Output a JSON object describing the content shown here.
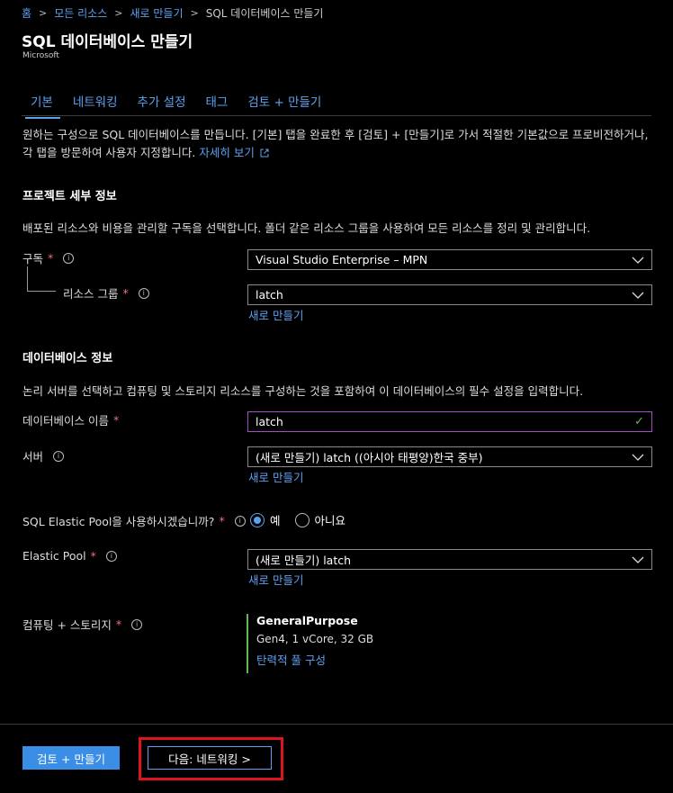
{
  "breadcrumb": [
    "홈",
    "모든 리소스",
    "새로 만들기",
    "SQL 데이터베이스 만들기"
  ],
  "header": {
    "title": "SQL 데이터베이스 만들기",
    "subtitle": "Microsoft"
  },
  "tabs": [
    {
      "label": "기본",
      "active": true
    },
    {
      "label": "네트워킹"
    },
    {
      "label": "추가 설정"
    },
    {
      "label": "태그"
    },
    {
      "label": "검토 + 만들기"
    }
  ],
  "intro": {
    "text": "원하는 구성으로 SQL 데이터베이스를 만듭니다. [기본] 탭을 완료한 후 [검토] + [만들기]로 가서 적절한 기본값으로 프로비전하거나, 각 탭을 방문하여 사용자 지정합니다. ",
    "link": "자세히 보기"
  },
  "project": {
    "title": "프로젝트 세부 정보",
    "desc": "배포된 리소스와 비용을 관리할 구독을 선택합니다. 폴더 같은 리소스 그룹을 사용하여 모든 리소스를 정리 및 관리합니다.",
    "subscription_label": "구독",
    "subscription_value": "Visual Studio Enterprise – MPN",
    "rg_label": "리소스 그룹",
    "rg_value": "latch",
    "rg_create": "새로 만들기"
  },
  "db": {
    "title": "데이터베이스 정보",
    "desc": "논리 서버를 선택하고 컴퓨팅 및 스토리지 리소스를 구성하는 것을 포함하여 이 데이터베이스의 필수 설정을 입력합니다.",
    "name_label": "데이터베이스 이름",
    "name_value": "latch",
    "server_label": "서버",
    "server_value": "(새로 만들기) latch ((아시아 태평양)한국 중부)",
    "server_create": "새로 만들기",
    "pool_question": "SQL Elastic Pool을 사용하시겠습니까?",
    "yes": "예",
    "no": "아니요",
    "pool_label": "Elastic Pool",
    "pool_value": "(새로 만들기) latch",
    "pool_create": "새로 만들기",
    "compute_label": "컴퓨팅 + 스토리지",
    "compute_name": "GeneralPurpose",
    "compute_detail": "Gen4, 1 vCore, 32 GB",
    "compute_link": "탄력적 풀 구성"
  },
  "footer": {
    "review_button": "검토 + 만들기",
    "next_button": "다음: 네트워킹 >"
  }
}
